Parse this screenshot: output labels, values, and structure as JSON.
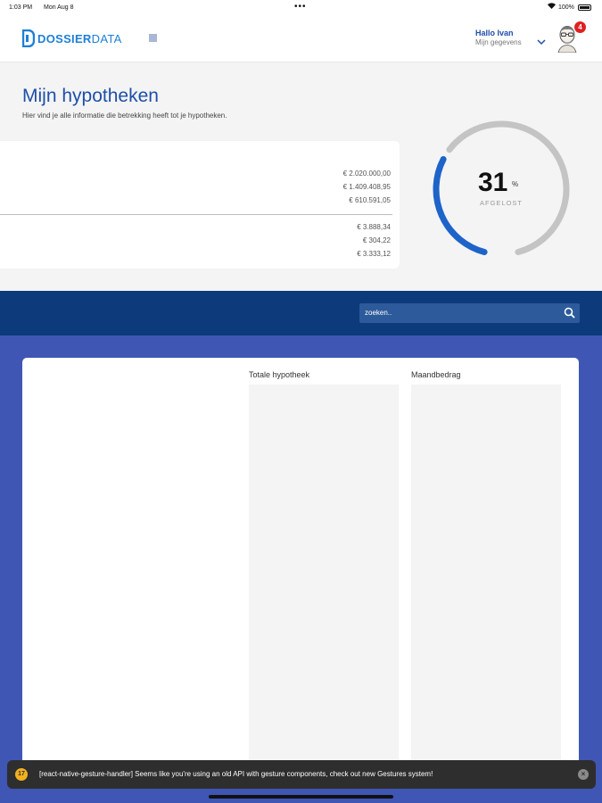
{
  "status_bar": {
    "time": "1:03 PM",
    "date": "Mon Aug 8",
    "dots": "•••",
    "battery": "100%"
  },
  "header": {
    "logo_part1": "DOSSIER",
    "logo_part2": "DATA",
    "greeting": "Hallo Ivan",
    "my_details": "Mijn gegevens",
    "notification_count": "4"
  },
  "page": {
    "title": "Mijn hypotheken",
    "subtitle": "Hier vind je alle informatie die betrekking heeft tot je hypotheken."
  },
  "summary": {
    "amounts_top": [
      "€ 2.020.000,00",
      "€ 1.409.408,95",
      "€ 610.591,05"
    ],
    "amounts_bottom": [
      "€ 3.888,34",
      "€ 304,22",
      "€ 3.333,12"
    ]
  },
  "gauge": {
    "value": "31",
    "unit": "%",
    "label": "AFGELOST",
    "fraction": 0.31,
    "colors": {
      "progress": "#1e63c9",
      "track": "#c4c4c4"
    }
  },
  "search": {
    "placeholder": "zoeken.."
  },
  "table": {
    "columns": [
      "Totale hypotheek",
      "Maandbedrag"
    ]
  },
  "toast": {
    "badge": "17",
    "message": "[react-native-gesture-handler] Seems like you're using an old API with gesture components, check out new Gestures system!",
    "close": "×"
  },
  "colors": {
    "brand": "#1e4fa8",
    "navbar": "#0c3a7a",
    "main_bg": "#3f56b5"
  }
}
